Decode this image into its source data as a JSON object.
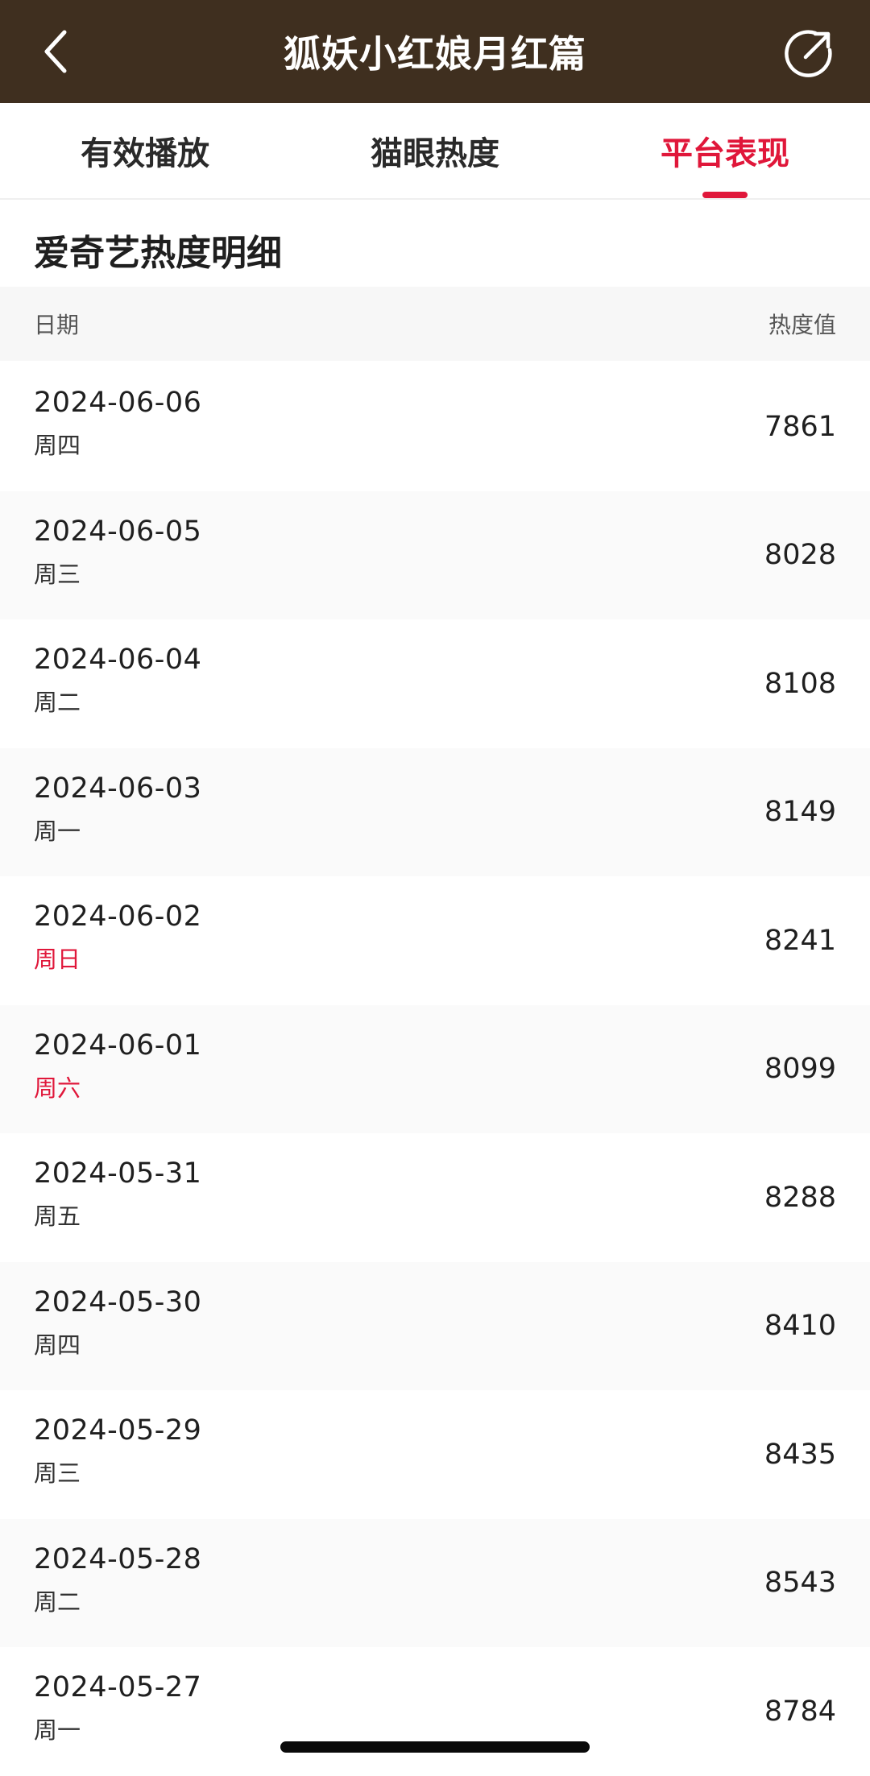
{
  "navbar": {
    "title": "狐妖小红娘月红篇",
    "back_icon": "back-arrow-icon",
    "share_icon": "share-icon"
  },
  "tabs": [
    {
      "label": "有效播放",
      "active": false
    },
    {
      "label": "猫眼热度",
      "active": false
    },
    {
      "label": "平台表现",
      "active": true
    }
  ],
  "section": {
    "title": "爱奇艺热度明细"
  },
  "table": {
    "headers": {
      "date": "日期",
      "value": "热度值"
    },
    "rows": [
      {
        "date": "2024-06-06",
        "weekday": "周四",
        "weekend": false,
        "value": "7861"
      },
      {
        "date": "2024-06-05",
        "weekday": "周三",
        "weekend": false,
        "value": "8028"
      },
      {
        "date": "2024-06-04",
        "weekday": "周二",
        "weekend": false,
        "value": "8108"
      },
      {
        "date": "2024-06-03",
        "weekday": "周一",
        "weekend": false,
        "value": "8149"
      },
      {
        "date": "2024-06-02",
        "weekday": "周日",
        "weekend": true,
        "value": "8241"
      },
      {
        "date": "2024-06-01",
        "weekday": "周六",
        "weekend": true,
        "value": "8099"
      },
      {
        "date": "2024-05-31",
        "weekday": "周五",
        "weekend": false,
        "value": "8288"
      },
      {
        "date": "2024-05-30",
        "weekday": "周四",
        "weekend": false,
        "value": "8410"
      },
      {
        "date": "2024-05-29",
        "weekday": "周三",
        "weekend": false,
        "value": "8435"
      },
      {
        "date": "2024-05-28",
        "weekday": "周二",
        "weekend": false,
        "value": "8543"
      },
      {
        "date": "2024-05-27",
        "weekday": "周一",
        "weekend": false,
        "value": "8784"
      }
    ]
  },
  "colors": {
    "navbar_bg": "#3f2f1f",
    "accent": "#e0173a",
    "text": "#1f1f1f",
    "header_bg": "#f7f7f7"
  }
}
